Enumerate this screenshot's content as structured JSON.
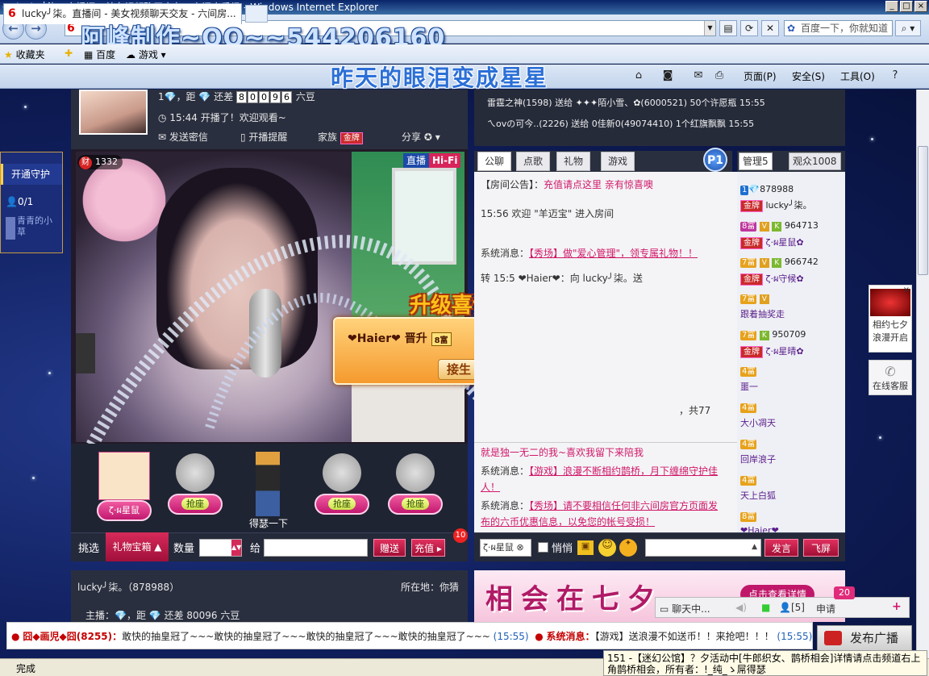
{
  "window": {
    "title": "lucky╯柒。直播间 - 美女视频聊天交友 - 六间房秀场 - Windows Internet Explorer"
  },
  "watermark": {
    "line1": "阿峰制作~QQ~~544206160",
    "line2": "昨天的眼泪变成星星"
  },
  "browser": {
    "search_placeholder": "百度一下，你就知道",
    "favorites_label": "收藏夹",
    "fav_items": [
      "百度",
      "游戏"
    ],
    "tab_title": "lucky╯柒。直播间 - 美女视频聊天交友 - 六间房...",
    "commands": [
      "页面(P)",
      "安全(S)",
      "工具(O)"
    ],
    "status": "完成"
  },
  "guard": {
    "open_label": "开通守护",
    "count": "0/1",
    "user": "青青的小草"
  },
  "host": {
    "distance_prefix": "，距",
    "gap_label": "还差",
    "digits": [
      "8",
      "0",
      "0",
      "9",
      "6"
    ],
    "next_level": "六豆",
    "live_time": "15:44 开播了！欢迎观看~",
    "send_msg": "发送密信",
    "remind": "开播提醒",
    "family": "家族",
    "family_badge": "金牌",
    "share": "分享"
  },
  "video": {
    "wealth": "1332",
    "wealth_label": "财",
    "live": "直播",
    "hifi": "Hi-Fi"
  },
  "upgrade": {
    "title": "升级喜讯",
    "user": "❤Haier❤ 晋升",
    "level": "8富",
    "button": "接生"
  },
  "seats": [
    {
      "name": "ζ·ผ星鼠",
      "grab": ""
    },
    {
      "name": "",
      "grab": "抢座"
    },
    {
      "name": "得瑟一下",
      "grab": ""
    },
    {
      "name": "",
      "grab": "抢座"
    },
    {
      "name": "",
      "grab": "抢座"
    }
  ],
  "giftbar": {
    "pick": "挑选",
    "box": "礼物宝箱",
    "qty": "数量",
    "to": "给",
    "give": "赠送",
    "recharge": "充值",
    "count": "10"
  },
  "host_bottom": {
    "name": "lucky╯柒。（878988）",
    "location": "所在地：你猜",
    "line": "主播：",
    "distance": "，距",
    "gap": "还差 80096 六豆"
  },
  "notices": [
    "雷霆之神(1598) 送给 ✦✦✦陌小雪、✿(6000521) 50个许愿瓶  15:55",
    "ㄟovの可今..(2226) 送给 0佳新0(49074410) 1个红旗飘飘  15:55"
  ],
  "chat_tabs": [
    "公聊",
    "点歌",
    "礼物",
    "游戏"
  ],
  "p1": "P1",
  "chat": [
    {
      "label": "【房间公告】：",
      "text": "充值请点这里 亲有惊喜噢"
    },
    {
      "label": "15:56 欢迎 ",
      "text": "\"羊迈宝\" 进入房间"
    },
    {
      "label": "系统消息：",
      "text": "【秀场】做\"爱心管理\"，领专属礼物！！"
    },
    {
      "label": "转 15:5",
      "text": "❤Haier❤：向 lucky╯柒。送"
    },
    {
      "label": "",
      "text": "，共77"
    }
  ],
  "chat2": [
    {
      "label": "",
      "text": "就是独一无二的我~喜欢我留下来陪我"
    },
    {
      "label": "系统消息：",
      "text": "【游戏】浪漫不断相约鹊桥，月下缠绵守护佳人！"
    },
    {
      "label": "系统消息：",
      "text": "【秀场】请不要相信任何非六间房官方页面发布的六币优惠信息，以免您的帐号受损！"
    }
  ],
  "user_tabs": [
    "管理5",
    "观众1008"
  ],
  "users": [
    {
      "lvl": "1",
      "id": "878988",
      "name": "lucky╯柒。",
      "badge": "金牌"
    },
    {
      "lvl": "8富",
      "id": "964713",
      "name": "ζ·ผ星鼠✿",
      "badge": "金牌"
    },
    {
      "lvl": "7富",
      "id": "966742",
      "name": "ζ·ผ守候✿",
      "badge": "金牌"
    },
    {
      "lvl": "7富",
      "id": "",
      "name": "跟着抽奖走",
      "badge": ""
    },
    {
      "lvl": "7富",
      "id": "950709",
      "name": "ζ·ผ星晴✿",
      "badge": "金牌"
    },
    {
      "lvl": "4富",
      "id": "",
      "name": "噩一",
      "badge": ""
    },
    {
      "lvl": "4富",
      "id": "",
      "name": "大小凋天",
      "badge": ""
    },
    {
      "lvl": "4富",
      "id": "",
      "name": "回岸浪子",
      "badge": ""
    },
    {
      "lvl": "4富",
      "id": "",
      "name": "天上白狐",
      "badge": ""
    },
    {
      "lvl": "8富",
      "id": "",
      "name": "❤Haier❤",
      "badge": ""
    }
  ],
  "inputbar": {
    "target": "ζ·ผ星鼠",
    "whisper": "悄悄",
    "send": "发言",
    "fly": "飞屏"
  },
  "banner": {
    "big": "相会在七夕",
    "detail": "点击查看详情"
  },
  "minibar": {
    "chat": "聊天中...",
    "people": "[5]",
    "apply": "申请",
    "badge": "20"
  },
  "sidead": {
    "text": "相约七夕浪漫开启"
  },
  "service": {
    "text": "在线客服"
  },
  "ticker": {
    "user": "囧◆画児◆囧(8255)：",
    "text": "敢快的抽皇冠了~~~敢快的抽皇冠了~~~敢快的抽皇冠了~~~敢快的抽皇冠了~~~",
    "time1": "(15:55)",
    "sys": "系统消息：",
    "sys_text": "【游戏】送浪漫不如送币！！来抢吧！！！",
    "time2": "(15:55)",
    "publish": "发布广播"
  },
  "popup": "151 -【迷幻公馆】？夕活动中[牛郎织女、鹊桥相会]详情请点击频道右上角鹊桥相会，所有者：!_纯_ゝ屌得瑟"
}
